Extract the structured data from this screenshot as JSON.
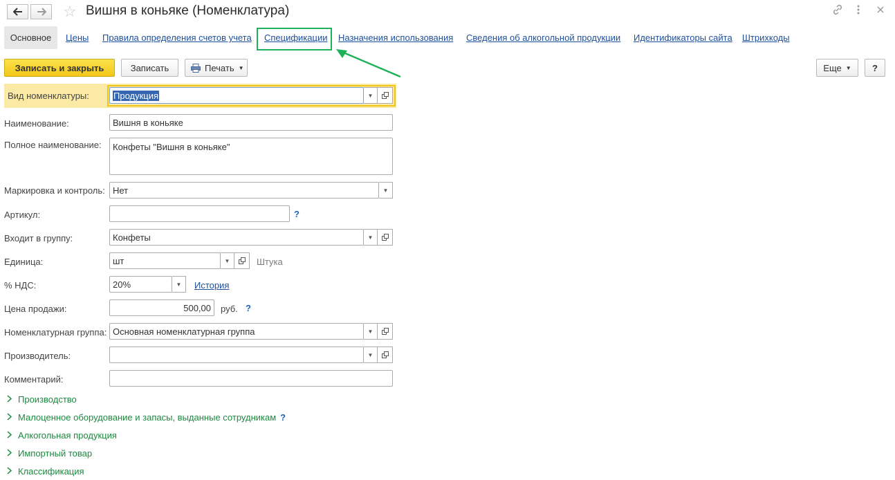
{
  "window": {
    "title": "Вишня в коньяке (Номенклатура)",
    "back_icon": "arrow-left-icon",
    "forward_icon": "arrow-right-icon",
    "favorite_icon": "star-icon",
    "link_icon": "link-icon",
    "menu_icon": "more-vertical-icon",
    "close_icon": "close-icon"
  },
  "tabs": [
    {
      "label": "Основное"
    },
    {
      "label": "Цены"
    },
    {
      "label": "Правила определения счетов учета"
    },
    {
      "label": "Спецификации"
    },
    {
      "label": "Назначения использования"
    },
    {
      "label": "Сведения об алкогольной продукции"
    },
    {
      "label": "Идентификаторы сайта"
    },
    {
      "label": "Штрихкоды"
    }
  ],
  "toolbar": {
    "save_close": "Записать и закрыть",
    "save": "Записать",
    "print": "Печать",
    "more": "Еще",
    "help": "?"
  },
  "form": {
    "kind": {
      "label": "Вид номенклатуры:",
      "value": "Продукция"
    },
    "name": {
      "label": "Наименование:",
      "value": "Вишня в коньяке"
    },
    "full_name": {
      "label": "Полное наименование:",
      "value": "Конфеты \"Вишня в коньяке\""
    },
    "marking": {
      "label": "Маркировка и контроль:",
      "value": "Нет"
    },
    "article": {
      "label": "Артикул:",
      "value": "",
      "help": "?"
    },
    "group": {
      "label": "Входит в группу:",
      "value": "Конфеты"
    },
    "unit": {
      "label": "Единица:",
      "value": "шт",
      "hint": "Штука"
    },
    "vat": {
      "label": "% НДС:",
      "value": "20%",
      "history_link": "История"
    },
    "price": {
      "label": "Цена продажи:",
      "value": "500,00",
      "currency": "руб.",
      "help": "?"
    },
    "nom_group": {
      "label": "Номенклатурная группа:",
      "value": "Основная номенклатурная группа"
    },
    "producer": {
      "label": "Производитель:",
      "value": ""
    },
    "comment": {
      "label": "Комментарий:",
      "value": ""
    }
  },
  "sections": [
    {
      "label": "Производство"
    },
    {
      "label": "Малоценное оборудование и запасы, выданные сотрудникам",
      "help": "?"
    },
    {
      "label": "Алкогольная продукция"
    },
    {
      "label": "Импортный товар"
    },
    {
      "label": "Классификация"
    }
  ],
  "colors": {
    "accent_green": "#1db15a",
    "primary_button": "#f2c617",
    "link": "#1c4f9c",
    "section_green": "#1a8a3e"
  }
}
